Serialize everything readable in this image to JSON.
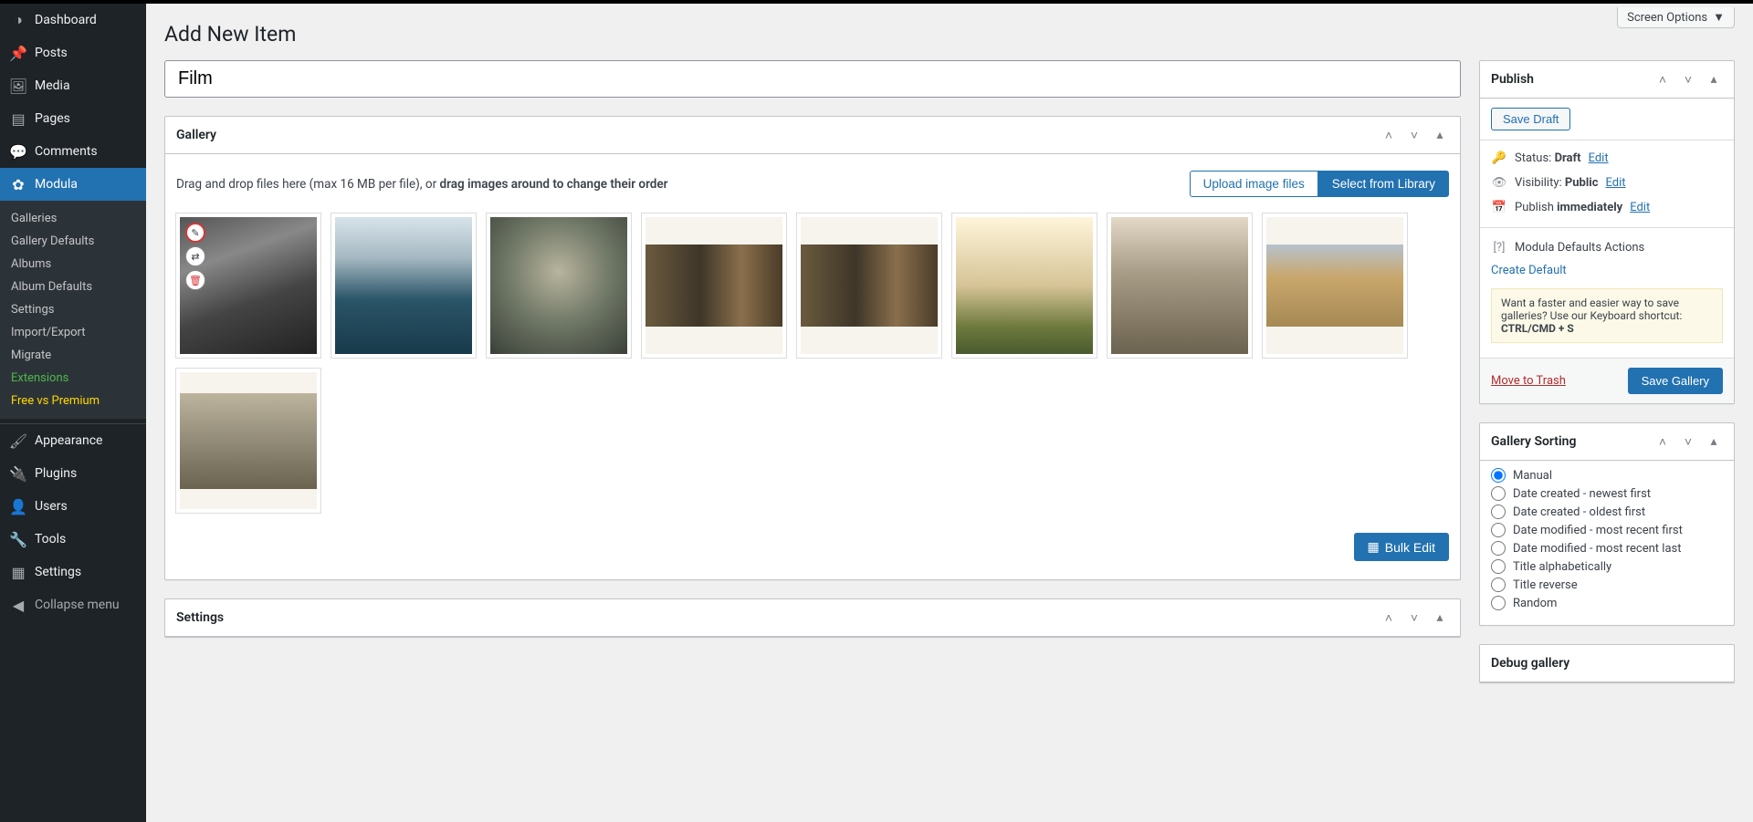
{
  "screen_options": "Screen Options",
  "page_title": "Add New Item",
  "title_value": "Film",
  "sidebar": {
    "main": [
      {
        "icon": "◑",
        "label": "Dashboard"
      },
      {
        "icon": "📌",
        "label": "Posts"
      },
      {
        "icon": "🖼",
        "label": "Media"
      },
      {
        "icon": "▤",
        "label": "Pages"
      },
      {
        "icon": "💬",
        "label": "Comments"
      },
      {
        "icon": "✿",
        "label": "Modula",
        "current": true
      }
    ],
    "sub": [
      {
        "label": "Galleries"
      },
      {
        "label": "Gallery Defaults"
      },
      {
        "label": "Albums"
      },
      {
        "label": "Album Defaults"
      },
      {
        "label": "Settings"
      },
      {
        "label": "Import/Export"
      },
      {
        "label": "Migrate"
      },
      {
        "label": "Extensions",
        "cls": "green"
      },
      {
        "label": "Free vs Premium",
        "cls": "yellow"
      }
    ],
    "bottom": [
      {
        "icon": "🖌",
        "label": "Appearance"
      },
      {
        "icon": "🔌",
        "label": "Plugins"
      },
      {
        "icon": "👤",
        "label": "Users"
      },
      {
        "icon": "🔧",
        "label": "Tools"
      },
      {
        "icon": "▦",
        "label": "Settings"
      }
    ],
    "collapse": {
      "icon": "◀",
      "label": "Collapse menu"
    }
  },
  "gallery": {
    "title": "Gallery",
    "drop_prefix": "Drag and drop files here (max 16 MB per file), or ",
    "drop_bold": "drag images around to change their order",
    "upload_btn": "Upload image files",
    "library_btn": "Select from Library",
    "bulk_edit": "Bulk Edit"
  },
  "settings_box": {
    "title": "Settings"
  },
  "publish": {
    "title": "Publish",
    "save_draft": "Save Draft",
    "status_label": "Status:",
    "status_value": "Draft",
    "vis_label": "Visibility:",
    "vis_value": "Public",
    "pub_label": "Publish",
    "pub_value": "immediately",
    "edit": "Edit",
    "defaults_title": "Modula Defaults Actions",
    "create_default": "Create Default",
    "shortcut": "Want a faster and easier way to save galleries? Use our Keyboard shortcut: ",
    "shortcut_key": "CTRL/CMD + S",
    "trash": "Move to Trash",
    "save_gallery": "Save Gallery"
  },
  "sorting": {
    "title": "Gallery Sorting",
    "options": [
      "Manual",
      "Date created - newest first",
      "Date created - oldest first",
      "Date modified - most recent first",
      "Date modified - most recent last",
      "Title alphabetically",
      "Title reverse",
      "Random"
    ]
  },
  "debug": {
    "title": "Debug gallery"
  }
}
